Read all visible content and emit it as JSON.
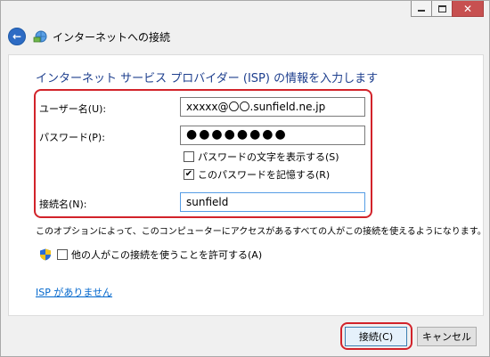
{
  "window": {
    "title": "インターネットへの接続"
  },
  "main_instruction": "インターネット サービス プロバイダー (ISP) の情報を入力します",
  "fields": {
    "username_label": "ユーザー名(U):",
    "username_value": "xxxxx@〇〇.sunfield.ne.jp",
    "password_label": "パスワード(P):",
    "password_value": "●●●●●●●●",
    "show_password_label": "パスワードの文字を表示する(S)",
    "show_password_checked": false,
    "remember_password_label": "このパスワードを記憶する(R)",
    "remember_password_checked": true,
    "connection_name_label": "接続名(N):",
    "connection_name_value": "sunfield"
  },
  "note": "このオプションによって、このコンピューターにアクセスがあるすべての人がこの接続を使えるようになります。",
  "share_label": "他の人がこの接続を使うことを許可する(A)",
  "share_checked": false,
  "no_isp_link": "ISP がありません",
  "buttons": {
    "connect": "接続(C)",
    "cancel": "キャンセル"
  },
  "colors": {
    "highlight_red": "#d2232a",
    "instruction_blue": "#1e3f8e",
    "link_blue": "#0066cc",
    "back_button_blue": "#2d6bc4"
  },
  "icons": {
    "back": "back-arrow-icon",
    "wizard": "network-wizard-icon",
    "shield": "uac-shield-icon",
    "checkmark": "check-mark"
  }
}
